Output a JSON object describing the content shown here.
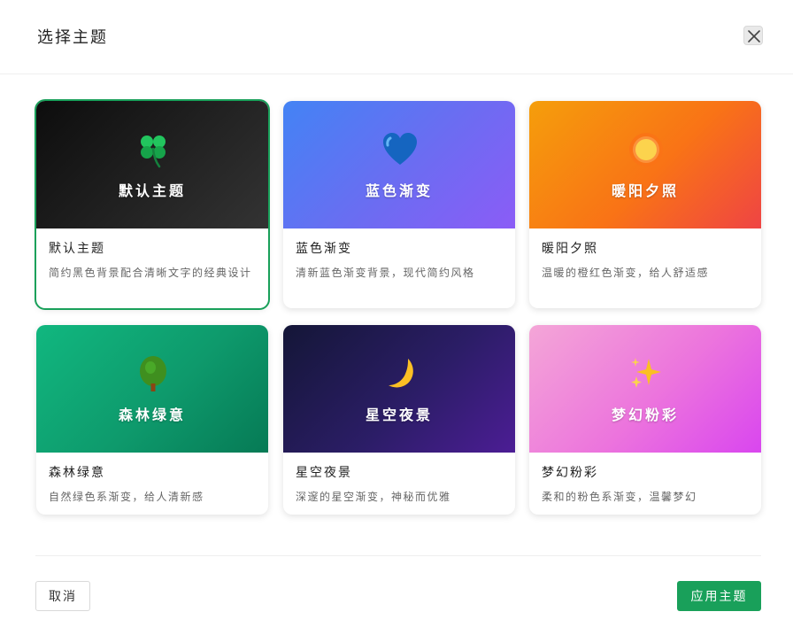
{
  "dialog": {
    "title": "选择主题",
    "close_icon": "close-icon"
  },
  "themes": [
    {
      "name": "默认主题",
      "desc": "简约黑色背景配合清晰文字的经典设计",
      "icon": "clover-icon",
      "selected": true
    },
    {
      "name": "蓝色渐变",
      "desc": "清新蓝色渐变背景，现代简约风格",
      "icon": "blue-heart-icon",
      "selected": false
    },
    {
      "name": "暖阳夕照",
      "desc": "温暖的橙红色渐变，给人舒适感",
      "icon": "sun-icon",
      "selected": false
    },
    {
      "name": "森林绿意",
      "desc": "自然绿色系渐变，给人清新感",
      "icon": "tree-icon",
      "selected": false
    },
    {
      "name": "星空夜景",
      "desc": "深邃的星空渐变，神秘而优雅",
      "icon": "moon-icon",
      "selected": false
    },
    {
      "name": "梦幻粉彩",
      "desc": "柔和的粉色系渐变，温馨梦幻",
      "icon": "sparkles-icon",
      "selected": false
    }
  ],
  "footer": {
    "cancel_label": "取消",
    "apply_label": "应用主题"
  },
  "colors": {
    "accent": "#19a05a",
    "selected_border": "#19a05a"
  }
}
